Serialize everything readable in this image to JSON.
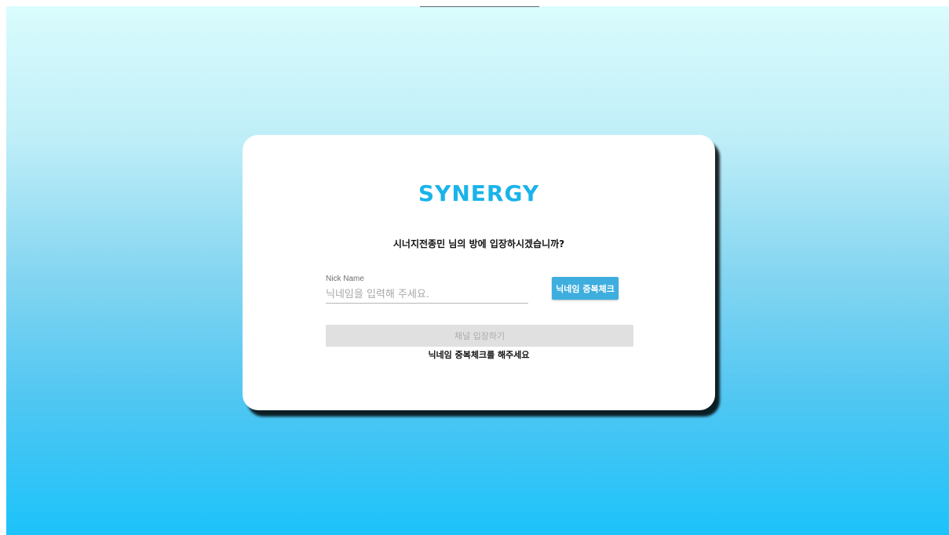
{
  "login": {
    "logo": "SYNERGY",
    "question": "시너지전종민 님의 방에 입장하시겠습니까?",
    "nickname_label": "Nick Name",
    "nickname_placeholder": "닉네임을 입력해 주세요.",
    "nickname_value": "",
    "check_button": "닉네임 중복체크",
    "enter_button": "채널 입장하기",
    "hint": "닉네임 중복체크를 해주세요"
  },
  "colors": {
    "brand": "#1ab3ea",
    "check_button_bg": "#3eaede",
    "enter_button_disabled_bg": "#e0e0e0",
    "background_top": "#dafcfd",
    "background_bottom": "#1cc3fa"
  }
}
